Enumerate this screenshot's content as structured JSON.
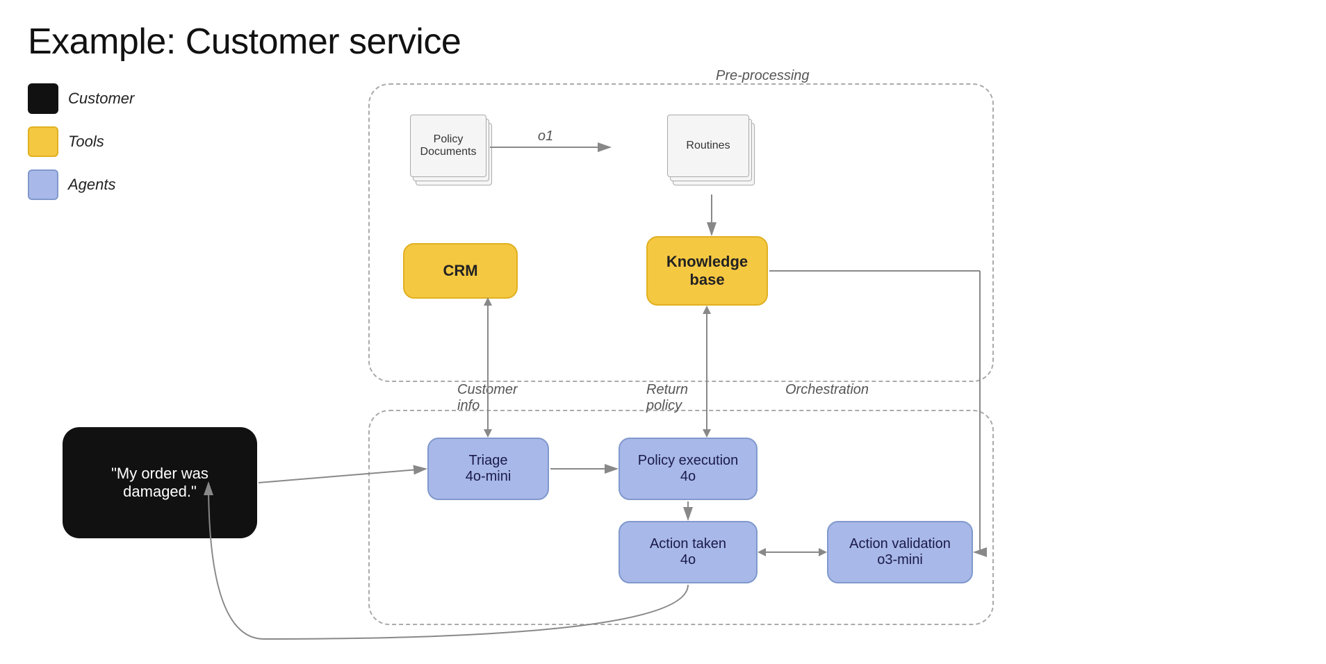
{
  "title": "Example: Customer service",
  "legend": [
    {
      "label": "Customer",
      "color": "#111111"
    },
    {
      "label": "Tools",
      "color": "#f5c842"
    },
    {
      "label": "Agents",
      "color": "#a8b8e8"
    }
  ],
  "labels": {
    "preprocessing": "Pre-processing",
    "o1": "o1",
    "policy_documents": "Policy\nDocuments",
    "routines": "Routines",
    "crm": "CRM",
    "knowledge_base": "Knowledge\nbase",
    "customer_message": "\"My order was damaged.\"",
    "triage": "Triage\n4o-mini",
    "policy_execution": "Policy execution\n4o",
    "action_taken": "Action taken\n4o",
    "action_validation": "Action validation\no3-mini",
    "customer_info": "Customer\ninfo",
    "return_policy": "Return\npolicy",
    "orchestration": "Orchestration"
  }
}
